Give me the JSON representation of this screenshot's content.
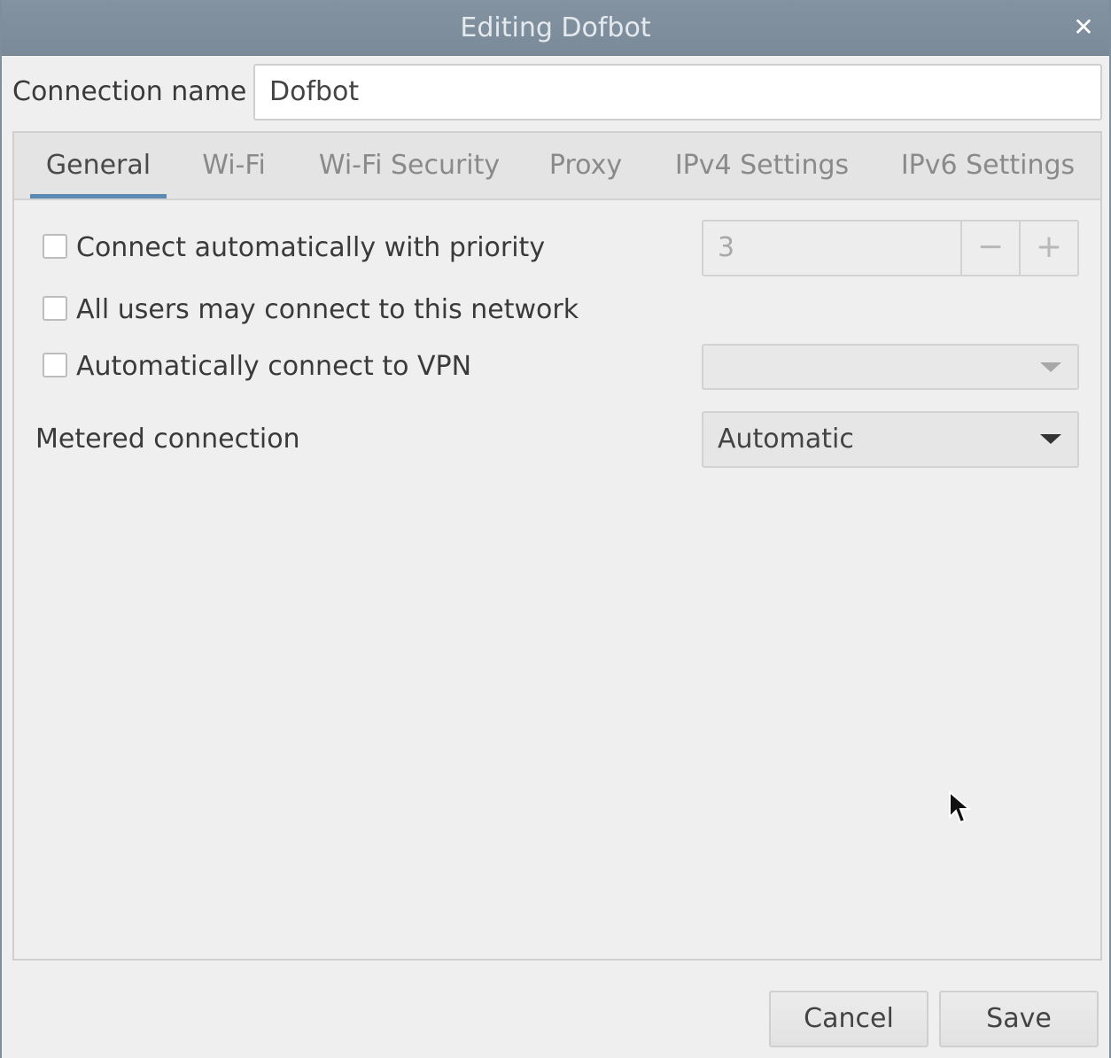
{
  "window": {
    "title": "Editing Dofbot",
    "close_glyph": "✕"
  },
  "connection": {
    "label": "Connection name",
    "value": "Dofbot"
  },
  "tabs": [
    {
      "label": "General",
      "active": true
    },
    {
      "label": "Wi-Fi",
      "active": false
    },
    {
      "label": "Wi-Fi Security",
      "active": false
    },
    {
      "label": "Proxy",
      "active": false
    },
    {
      "label": "IPv4 Settings",
      "active": false
    },
    {
      "label": "IPv6 Settings",
      "active": false
    }
  ],
  "general": {
    "auto_connect": {
      "label": "Connect automatically with priority",
      "checked": false
    },
    "priority": {
      "value": "3",
      "minus": "−",
      "plus": "+"
    },
    "all_users": {
      "label": "All users may connect to this network",
      "checked": false
    },
    "auto_vpn": {
      "label": "Automatically connect to VPN",
      "checked": false
    },
    "vpn_select": {
      "value": ""
    },
    "metered": {
      "label": "Metered connection",
      "value": "Automatic"
    }
  },
  "buttons": {
    "cancel": "Cancel",
    "save": "Save"
  },
  "colors": {
    "titlebar": "#7a8a99",
    "accent": "#5d8ab3",
    "background": "#efefef"
  }
}
